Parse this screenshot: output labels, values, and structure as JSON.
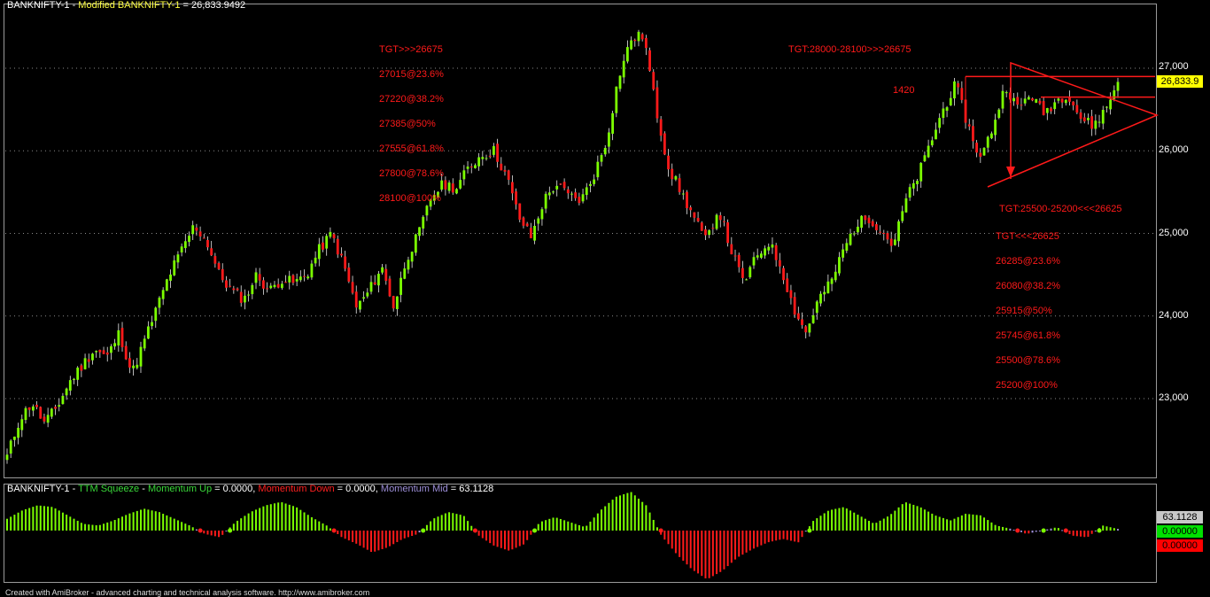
{
  "price_title": {
    "symbol": "BANKNIFTY-1",
    "sep": " - ",
    "modified": "Modified BANKNIFTY-1",
    "eq": " = ",
    "value": "26,833.9492"
  },
  "indicator_title": {
    "symbol": "BANKNIFTY-1",
    "sep": " - ",
    "name": "TTM Squeeze",
    "up_label": "Momentum Up",
    "up_value": " = 0.0000, ",
    "down_label": "Momentum Down",
    "down_value": " = 0.0000, ",
    "mid_label": "Momentum Mid",
    "mid_value": " = 63.1128"
  },
  "annotations_upper": [
    "TGT>>>26675",
    "27015@23.6%",
    "27220@38.2%",
    "27385@50%",
    "27555@61.8%",
    "27800@78.6%",
    "28100@100%"
  ],
  "annotation_top_right": "TGT:28000-28100>>>26675",
  "annotation_1420": "1420",
  "annotation_lower_head": "TGT:25500-25200<<<26625",
  "annotations_lower": [
    "TGT<<<26625",
    "26285@23.6%",
    "26080@38.2%",
    "25915@50%",
    "25745@61.8%",
    "25500@78.6%",
    "25200@100%"
  ],
  "y_axis_labels": [
    "27,000",
    "26,000",
    "25,000",
    "24,000",
    "23,000"
  ],
  "price_badge": "26,833.9",
  "indicator_badges": [
    "63.1128",
    "0.00000",
    "0.00000"
  ],
  "footer": "Created with AmiBroker - advanced charting and technical analysis software. http://www.amibroker.com",
  "colors": {
    "up": "#7cff00",
    "down": "#ff1a1a",
    "mid": "#9d8fd8",
    "grid": "#8a8a8a",
    "badge_price": "#ffff00"
  },
  "chart_data": [
    {
      "type": "candlestick",
      "title": "BANKNIFTY-1 - Modified BANKNIFTY-1 = 26,833.9492",
      "ylim": [
        22200,
        27700
      ],
      "y_ticks": [
        23000,
        24000,
        25000,
        26000,
        27000
      ],
      "last_close": 26833.9492,
      "close_path": [
        22300,
        22750,
        22950,
        22700,
        22900,
        23200,
        23400,
        23600,
        23500,
        23800,
        23300,
        23700,
        24100,
        24500,
        24800,
        25100,
        24900,
        24500,
        24300,
        24200,
        24500,
        24300,
        24450,
        24400,
        24500,
        24800,
        25000,
        24600,
        24100,
        24300,
        24600,
        24100,
        24700,
        25000,
        25450,
        25600,
        25550,
        25800,
        25950,
        26000,
        25700,
        25200,
        24950,
        25400,
        25600,
        25450,
        25400,
        25700,
        26100,
        26900,
        27350,
        27400,
        26500,
        25800,
        25500,
        25200,
        24900,
        25300,
        24800,
        24400,
        24700,
        24900,
        24600,
        24100,
        23800,
        24200,
        24400,
        24800,
        25100,
        25200,
        25050,
        24850,
        25400,
        25700,
        26100,
        26500,
        26800,
        26300,
        25900,
        26300,
        26800,
        26500,
        26700,
        26450,
        26600,
        26700,
        26400,
        26300,
        26500,
        26834
      ],
      "levels": [
        26900,
        26650
      ],
      "momentum_mid_value": 63.1128
    },
    {
      "type": "bar",
      "title": "BANKNIFTY-1 - TTM Squeeze",
      "series_names": [
        "Momentum Up",
        "Momentum Down",
        "Momentum Mid"
      ],
      "values": [
        14,
        24,
        30,
        28,
        18,
        8,
        6,
        12,
        20,
        26,
        22,
        14,
        6,
        -4,
        -8,
        10,
        22,
        30,
        34,
        28,
        16,
        6,
        -8,
        -16,
        -26,
        -20,
        -10,
        -4,
        14,
        22,
        18,
        -6,
        -18,
        -24,
        -16,
        10,
        16,
        10,
        4,
        24,
        40,
        46,
        30,
        -6,
        -28,
        -46,
        -58,
        -48,
        -32,
        -22,
        -14,
        -10,
        -14,
        12,
        24,
        28,
        18,
        8,
        18,
        34,
        28,
        18,
        12,
        20,
        18,
        6,
        2,
        -4,
        0,
        4,
        -6,
        -8,
        6,
        2
      ]
    }
  ]
}
